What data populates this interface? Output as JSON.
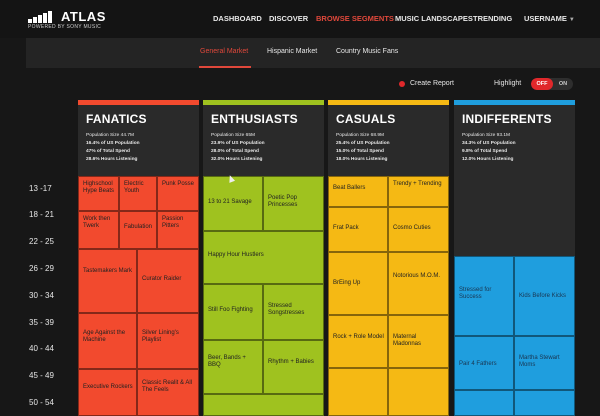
{
  "app": {
    "logo_text": "ATLAS",
    "logo_sub": "POWERED BY SONY MUSIC"
  },
  "nav": {
    "items": [
      "DASHBOARD",
      "DISCOVER",
      "BROWSE SEGMENTS",
      "MUSIC LANDSCAPES",
      "TRENDING",
      "USERNAME"
    ],
    "active": "BROWSE SEGMENTS"
  },
  "subnav": {
    "tabs": [
      "General Market",
      "Hispanic Market",
      "Country Music Fans"
    ],
    "active": "General Market"
  },
  "toolbar": {
    "create_report": "Create Report",
    "highlight": "Highlight",
    "toggle_off": "OFF",
    "toggle_on": "ON"
  },
  "ages": [
    "13 -17",
    "18 - 21",
    "22 - 25",
    "26 - 29",
    "30 - 34",
    "35 - 39",
    "40 - 44",
    "45 - 49",
    "50 - 54"
  ],
  "colors": {
    "fanatics": "#f24a2e",
    "enthusiasts": "#9fc21f",
    "casuals": "#f5b914",
    "indifferents": "#1f9ede",
    "accent": "#e0483b"
  },
  "segments": [
    {
      "title": "FANATICS",
      "stats": [
        "Population Size 44.7M",
        "16.4% of US Population",
        "47% of Total Spend",
        "28.6% Hours Listening"
      ],
      "cells": [
        "Highschool Hype Beats",
        "Electric Youth",
        "Punk Posse",
        "Work then Twerk",
        "Fabulation",
        "Passion Pitters",
        "Tastemakers Mark",
        "Curator Raider",
        "Age Against the Machine",
        "Silver Lining's Playlist",
        "Executive Rockers",
        "Classic Realit & All The Feels"
      ]
    },
    {
      "title": "ENTHUSIASTS",
      "stats": [
        "Population Size 65M",
        "23.9% of US Population",
        "28.0% of Total Spend",
        "32.0% Hours Listening"
      ],
      "cells": [
        "13 to 21 Savage",
        "Poetic Pop Princesses",
        "Happy Hour Hustlers",
        "Still Foo Fighting",
        "Stressed Songstresses",
        "Beer, Bands + BBQ",
        "Rhythm + Babies",
        ""
      ]
    },
    {
      "title": "CASUALS",
      "stats": [
        "Population Size 68.9M",
        "25.4% of US Population",
        "15.0% of Total Spend",
        "18.0% Hours Listening"
      ],
      "cells": [
        "Beat Ballers",
        "Trendy + Trending",
        "Frat Pack",
        "Cosmo Cuties",
        "BrEing Up",
        "Notorious M.O.M.",
        "Rock + Role Model",
        "Maternal Madonnas",
        "",
        ""
      ]
    },
    {
      "title": "INDIFFERENTS",
      "stats": [
        "Population Size 93.1M",
        "34.3% of US Population",
        "9.8% of Total Spend",
        "12.0% Hours Listening"
      ],
      "cells": [
        "Stressed for Success",
        "Kids Before Kicks",
        "Pair 4 Fathers",
        "Martha Stewart Moms",
        "",
        ""
      ]
    }
  ]
}
